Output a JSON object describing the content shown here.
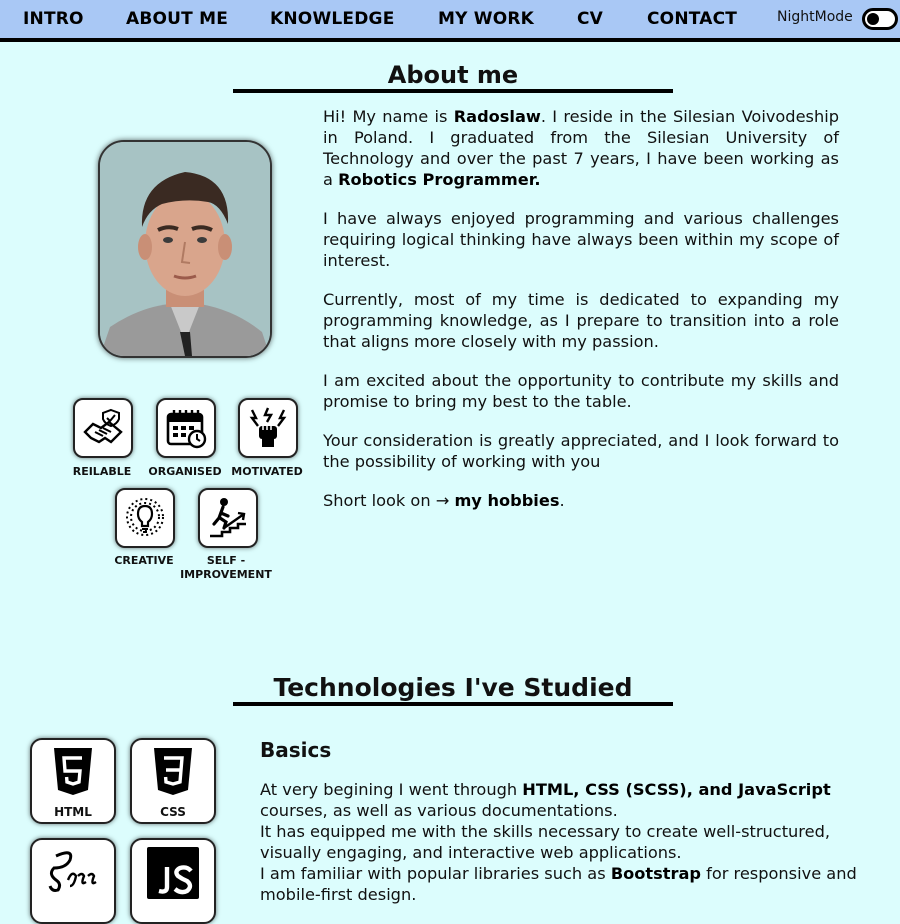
{
  "nav": {
    "items": [
      "INTRO",
      "ABOUT ME",
      "KNOWLEDGE",
      "MY WORK",
      "CV",
      "CONTACT"
    ],
    "nightmode_label": "NightMode"
  },
  "about": {
    "title": "About me",
    "p1_a": "Hi! My name is ",
    "p1_name": "Radoslaw",
    "p1_b": ". I reside in the Silesian Voivodeship in Poland. I graduated from the Silesian University of Technology and over the past 7 years, I have been working as a ",
    "p1_role": "Robotics Programmer.",
    "p2": "I have always enjoyed programming and various challenges requiring logical thinking have always been within my scope of interest.",
    "p3": "Currently, most of my time is dedicated to expanding my programming knowledge, as I prepare to transition into a role that aligns more closely with my passion.",
    "p4": "I am excited about the opportunity to contribute my skills and promise to bring my best to the table.",
    "p5": "Your consideration is greatly appreciated, and I look forward to the possibility of working with you",
    "p6_a": "Short look on → ",
    "p6_link": "my hobbies",
    "p6_b": "."
  },
  "traits": [
    {
      "label": "REILABLE",
      "icon": "handshake-icon"
    },
    {
      "label": "ORGANISED",
      "icon": "calendar-icon"
    },
    {
      "label": "MOTIVATED",
      "icon": "fist-lightning-icon"
    },
    {
      "label": "CREATIVE",
      "icon": "lightbulb-icon"
    },
    {
      "label": "SELF -",
      "label2": "IMPROVEMENT",
      "icon": "stairs-climb-icon"
    }
  ],
  "tech": {
    "title": "Technologies I've Studied",
    "cards": [
      {
        "label": "HTML",
        "icon": "html5-icon"
      },
      {
        "label": "CSS",
        "icon": "css3-icon"
      },
      {
        "label": "",
        "icon": "sass-icon"
      },
      {
        "label": "",
        "icon": "js-icon"
      }
    ],
    "basics_title": "Basics",
    "b1_a": "At very begining I went through ",
    "b1_bold": "HTML, CSS (SCSS), and JavaScript",
    "b1_b": " courses, as well as various documentations.",
    "b2": "It has equipped me with the skills necessary to create well-structured, visually engaging, and interactive web applications.",
    "b3_a": "I am familiar with popular libraries such as ",
    "b3_bold": "Bootstrap",
    "b3_b": " for responsive and mobile-first design."
  }
}
